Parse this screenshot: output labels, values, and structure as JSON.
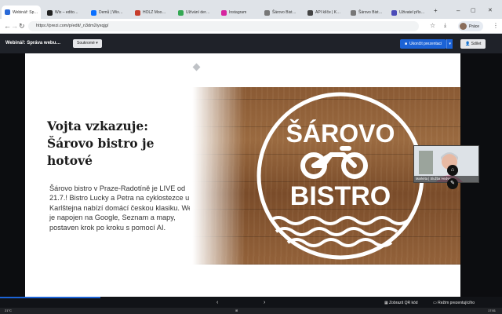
{
  "browser": {
    "tabs": [
      {
        "label": "Webinář: Sp…",
        "active": true,
        "color": "#2a6ad8"
      },
      {
        "label": "Wix – edito…",
        "active": false,
        "color": "#222222"
      },
      {
        "label": "Demů | Wix…",
        "active": false,
        "color": "#0b70ff"
      },
      {
        "label": "HOLZ Moo…",
        "active": false,
        "color": "#c73d2b"
      },
      {
        "label": "Užívání der…",
        "active": false,
        "color": "#34a853"
      },
      {
        "label": "Instagram",
        "active": false,
        "color": "#d6249f"
      },
      {
        "label": "Šárovo Bist…",
        "active": false,
        "color": "#777777"
      },
      {
        "label": "API klíče | K…",
        "active": false,
        "color": "#444444"
      },
      {
        "label": "Šárovo Bist…",
        "active": false,
        "color": "#777777"
      },
      {
        "label": "Uživatel přís…",
        "active": false,
        "color": "#4b4bb8"
      }
    ],
    "url": "https://prezi.com/p/edit/_n3dm2iyxqjg/",
    "profile_label": "Práce",
    "window_controls": {
      "minimize": "–",
      "maximize": "▢",
      "close": "✕"
    }
  },
  "prezi": {
    "deck_title": "Webinář: Správa webu…",
    "private_label": "Soukromé",
    "end_presentation_label": "Ukončit prezentaci",
    "files_label": "Sdílet"
  },
  "slide": {
    "headline": "Vojta vzkazuje: Šárovo bistro je hotové",
    "body": "Šárovo bistro v Praze-Radotíně je LIVE od 21.7.! Bistro Lucky a Petra na cyklostezce u Karlštejna nabízí domácí českou klasiku. Web je napojen na Google, Seznam a mapy, postaven krok po kroku s pomocí AI.",
    "logo": {
      "top_text": "ŠÁROVO",
      "bottom_text": "BISTRO",
      "icon": "bicycle-icon"
    },
    "colors": {
      "wood": "#8a5a34",
      "logo_white": "#ffffff"
    }
  },
  "webcam": {
    "label": "Markéta | Služba Hedvy"
  },
  "side_controls": [
    {
      "icon": "home-icon"
    },
    {
      "icon": "pen-icon"
    }
  ],
  "bottom_bar": {
    "prev_icon": "chevron-left-icon",
    "next_icon": "chevron-right-icon",
    "qr_label": "Zobrazit QR kód",
    "presenter_label": "Režim prezentujícího",
    "progress": 0.2
  },
  "taskbar": {
    "temp": "21°C",
    "time": "17:51"
  }
}
